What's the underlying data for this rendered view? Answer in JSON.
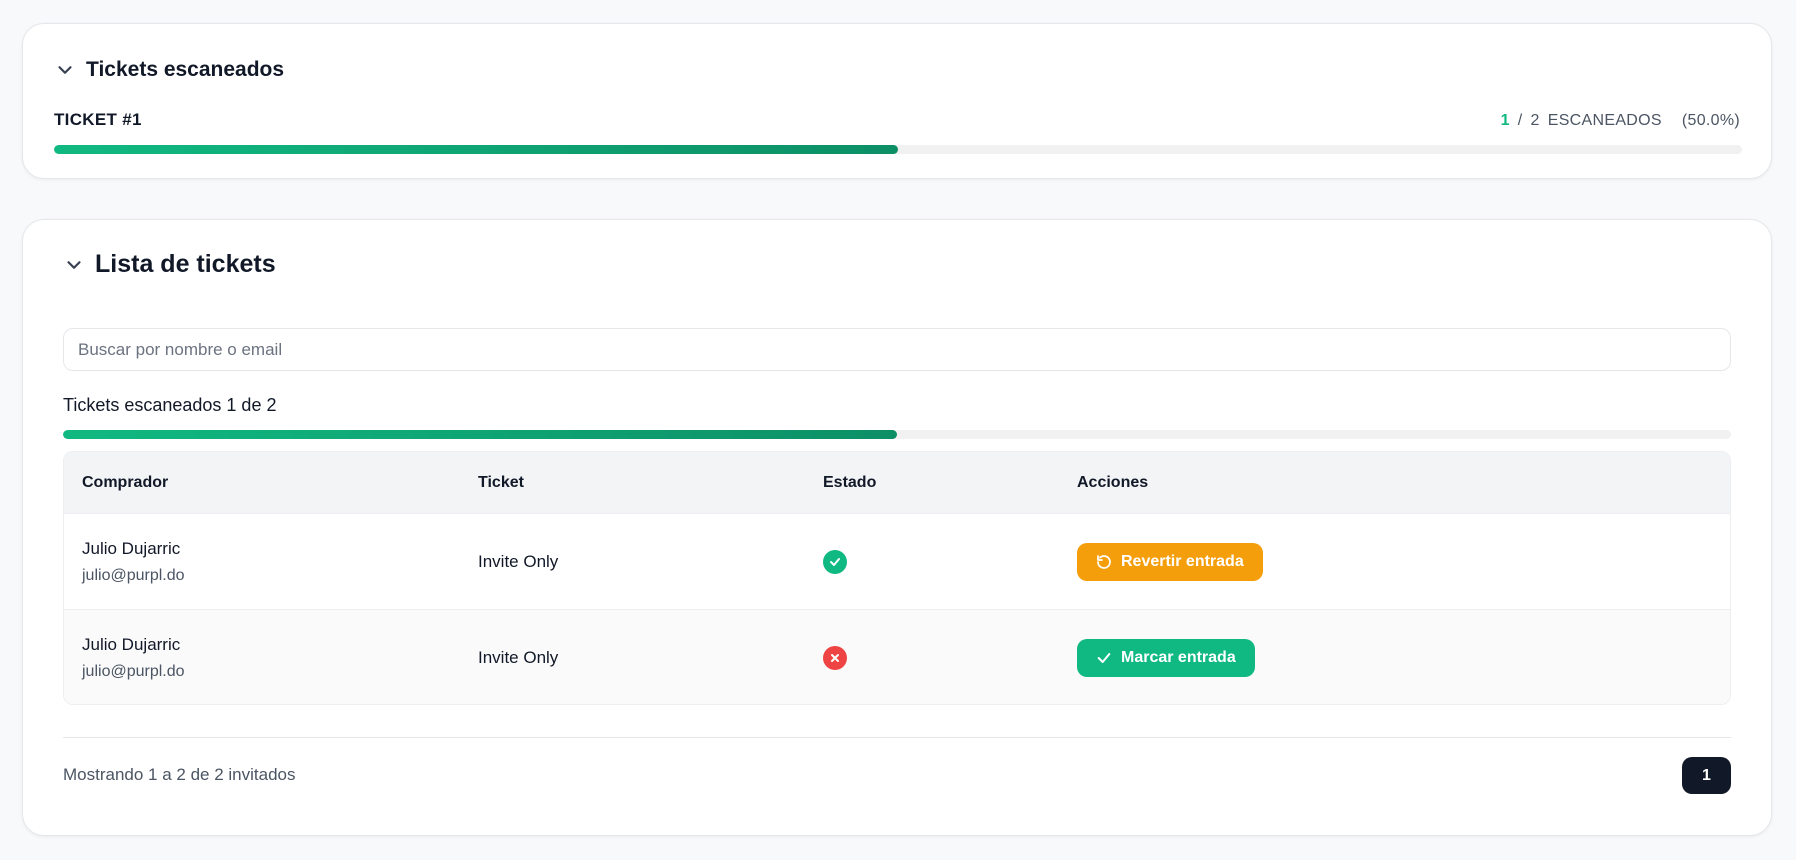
{
  "summary": {
    "title": "Tickets escaneados",
    "ticket_label": "TICKET #1",
    "scanned": "1",
    "separator": "/",
    "total": "2",
    "scanned_word": "ESCANEADOS",
    "percent_text": "(50.0%)",
    "progress": 0.5
  },
  "list": {
    "title": "Lista de tickets",
    "search_placeholder": "Buscar por nombre o email",
    "search_value": "",
    "scan_status": "Tickets escaneados 1 de 2",
    "progress": 0.5,
    "columns": [
      "Comprador",
      "Ticket",
      "Estado",
      "Acciones"
    ],
    "rows": [
      {
        "name": "Julio Dujarric",
        "email": "julio@purpl.do",
        "ticket": "Invite Only",
        "status": "check-circle-icon",
        "action_label": "Revertir entrada",
        "action_icon": "undo-icon"
      },
      {
        "name": "Julio Dujarric",
        "email": "julio@purpl.do",
        "ticket": "Invite Only",
        "status": "x-circle-icon",
        "action_label": "Marcar entrada",
        "action_icon": "check-icon"
      }
    ],
    "footer_text": "Mostrando 1 a 2 de 2 invitados",
    "current_page": "1"
  },
  "colors": {
    "accent_green": "#10b981",
    "revert_orange": "#f59e0b",
    "error_red": "#ef4444",
    "page_dark": "#111827"
  }
}
